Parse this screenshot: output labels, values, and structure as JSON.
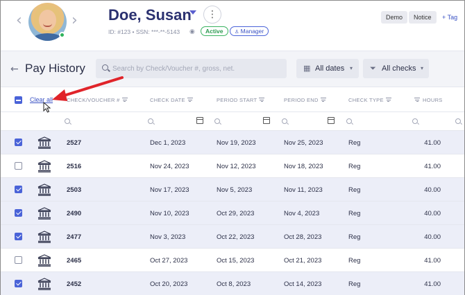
{
  "header": {
    "name": "Doe, Susan",
    "id_line": "ID: #123 • SSN: ***-**-5143",
    "status_badge": "Active",
    "role_badge": "Manager",
    "tags": [
      "Demo",
      "Notice"
    ],
    "add_tag": "+ Tag",
    "icons": {
      "prev": "chevron-left-icon",
      "next": "chevron-right-icon",
      "more": "kebab-icon",
      "visibility": "eye-icon"
    }
  },
  "toolbar": {
    "title": "Pay History",
    "search_placeholder": "Search by Check/Voucher #, gross, net.",
    "date_filter": "All dates",
    "check_filter": "All checks"
  },
  "table": {
    "clear_all": "Clear all",
    "columns": [
      "Check/Voucher #",
      "Check Date",
      "Period Start",
      "Period End",
      "Check Type",
      "Hours"
    ],
    "rows": [
      {
        "selected": true,
        "check": "2527",
        "date": "Dec 1, 2023",
        "start": "Nov 19, 2023",
        "end": "Nov 25, 2023",
        "type": "Reg",
        "hours": "41.00"
      },
      {
        "selected": false,
        "check": "2516",
        "date": "Nov 24, 2023",
        "start": "Nov 12, 2023",
        "end": "Nov 18, 2023",
        "type": "Reg",
        "hours": "41.00"
      },
      {
        "selected": true,
        "check": "2503",
        "date": "Nov 17, 2023",
        "start": "Nov 5, 2023",
        "end": "Nov 11, 2023",
        "type": "Reg",
        "hours": "40.00"
      },
      {
        "selected": true,
        "check": "2490",
        "date": "Nov 10, 2023",
        "start": "Oct 29, 2023",
        "end": "Nov 4, 2023",
        "type": "Reg",
        "hours": "40.00"
      },
      {
        "selected": true,
        "check": "2477",
        "date": "Nov 3, 2023",
        "start": "Oct 22, 2023",
        "end": "Oct 28, 2023",
        "type": "Reg",
        "hours": "40.00"
      },
      {
        "selected": false,
        "check": "2465",
        "date": "Oct 27, 2023",
        "start": "Oct 15, 2023",
        "end": "Oct 21, 2023",
        "type": "Reg",
        "hours": "41.00"
      },
      {
        "selected": true,
        "check": "2452",
        "date": "Oct 20, 2023",
        "start": "Oct 8, 2023",
        "end": "Oct 14, 2023",
        "type": "Reg",
        "hours": "41.00"
      }
    ]
  },
  "colors": {
    "accent": "#4a63d8",
    "active": "#38b25f",
    "annotation": "#e0242a",
    "selected_row": "#eceef8"
  }
}
